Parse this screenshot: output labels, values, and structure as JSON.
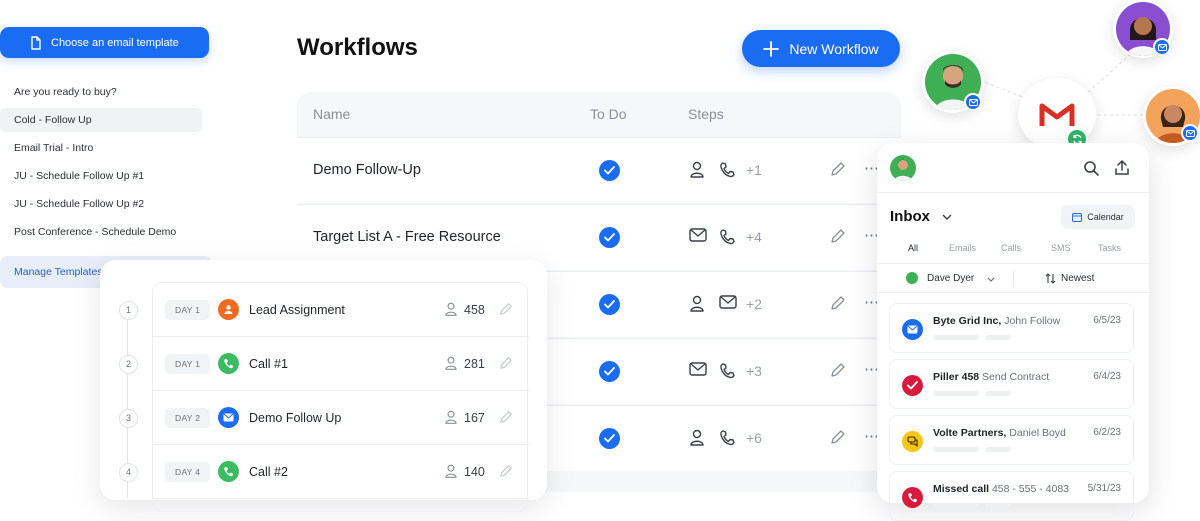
{
  "templates": {
    "choose_button": "Choose an email template",
    "items": [
      {
        "label": "Are you ready to buy?",
        "selected": false
      },
      {
        "label": "Cold - Follow Up",
        "selected": true
      },
      {
        "label": "Email Trial - Intro",
        "selected": false
      },
      {
        "label": "JU - Schedule Follow Up #1",
        "selected": false
      },
      {
        "label": "JU - Schedule Follow Up #2",
        "selected": false
      },
      {
        "label": "Post Conference - Schedule Demo",
        "selected": false
      }
    ],
    "manage_label": "Manage Templates"
  },
  "workflows": {
    "title": "Workflows",
    "new_button": "New Workflow",
    "columns": {
      "name": "Name",
      "todo": "To Do",
      "steps": "Steps"
    },
    "rows": [
      {
        "name": "Demo Follow-Up",
        "steps": [
          "person",
          "phone"
        ],
        "extra": "+1"
      },
      {
        "name": "Target List A - Free Resource",
        "steps": [
          "mail",
          "phone"
        ],
        "extra": "+4"
      },
      {
        "name": "",
        "steps": [
          "person",
          "mail"
        ],
        "extra": "+2"
      },
      {
        "name": "",
        "steps": [
          "mail",
          "phone"
        ],
        "extra": "+3"
      },
      {
        "name": "",
        "steps": [
          "person",
          "phone"
        ],
        "extra": "+6"
      }
    ]
  },
  "sequence": {
    "steps": [
      {
        "num": "1",
        "day": "DAY 1",
        "name": "Lead Assignment",
        "count": "458",
        "icon": "person-icon",
        "color": "#f26b21"
      },
      {
        "num": "2",
        "day": "DAY 1",
        "name": "Call #1",
        "count": "281",
        "icon": "phone-icon",
        "color": "#3dbb62"
      },
      {
        "num": "3",
        "day": "DAY 2",
        "name": "Demo Follow Up",
        "count": "167",
        "icon": "mail-icon",
        "color": "#1a6cf2"
      },
      {
        "num": "4",
        "day": "DAY 4",
        "name": "Call #2",
        "count": "140",
        "icon": "phone-icon",
        "color": "#3dbb62"
      }
    ]
  },
  "inbox": {
    "title": "Inbox",
    "calendar_label": "Calendar",
    "tabs": [
      "All",
      "Emails",
      "Calls",
      "SMS",
      "Tasks"
    ],
    "active_tab": "All",
    "user_filter": "Dave Dyer",
    "sort": "Newest",
    "messages": [
      {
        "company": "Byte Grid Inc,",
        "contact": "John Follow",
        "date": "6/5/23",
        "icon": "mail-icon",
        "color": "#1a6cf2"
      },
      {
        "company": "Piller 458",
        "contact": "Send Contract",
        "date": "6/4/23",
        "icon": "check-icon",
        "color": "#d81b3c"
      },
      {
        "company": "Volte Partners,",
        "contact": "Daniel Boyd",
        "date": "6/2/23",
        "icon": "chat-icon",
        "color": "#f5c518"
      },
      {
        "company": "Missed call",
        "contact": "458 - 555 - 4083",
        "date": "5/31/23",
        "icon": "phone-icon",
        "color": "#d81b3c"
      }
    ]
  },
  "colors": {
    "accent": "#1a6cf2",
    "gmail_red": "#d93025",
    "sync_green": "#2fb36b"
  }
}
